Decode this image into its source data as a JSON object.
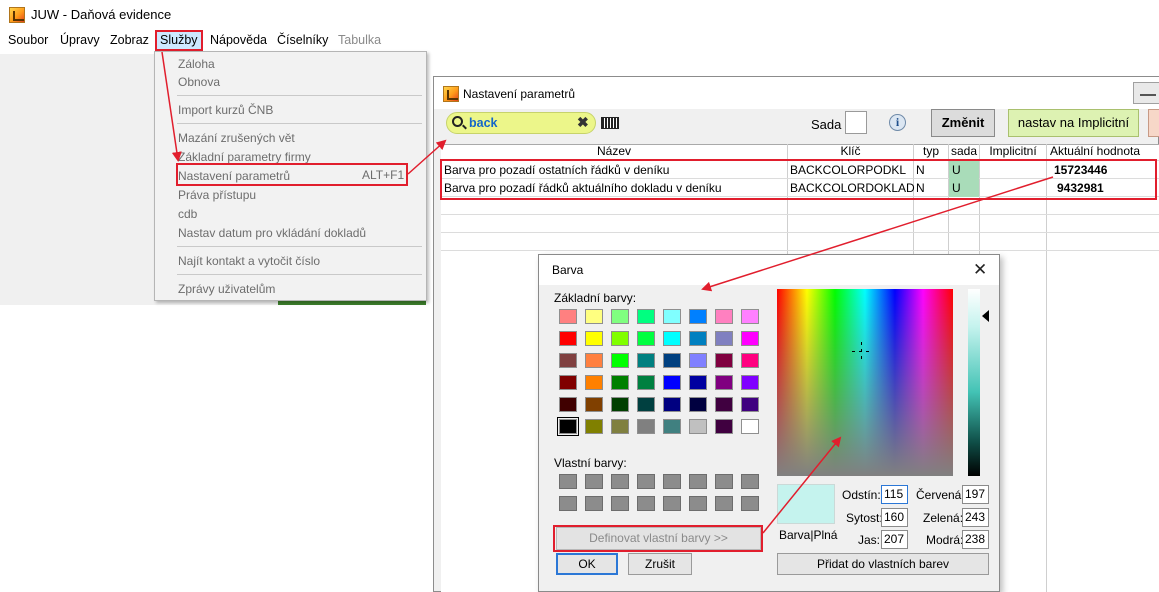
{
  "main_window": {
    "title": "JUW - Daňová evidence",
    "menu": [
      "Soubor",
      "Úpravy",
      "Zobraz",
      "Služby",
      "Nápověda",
      "Číselníky",
      "Tabulka"
    ]
  },
  "dropdown": {
    "items": [
      "Záloha",
      "Obnova",
      "Import kurzů ČNB",
      "Mazání zrušených vět",
      "Základní parametry firmy",
      "Nastavení parametrů",
      "Práva přístupu",
      "cdb",
      "Nastav datum pro vkládání dokladů",
      "Najít kontakt a vytočit číslo",
      "Zprávy uživatelům"
    ],
    "shortcut": "ALT+F1"
  },
  "params_window": {
    "title": "Nastavení parametrů",
    "search_value": "back",
    "clear_glyph": "✖",
    "sada_label": "Sada",
    "info_glyph": "i",
    "btn_change": "Změnit",
    "btn_implicit": "nastav na Implicitní",
    "columns": [
      "Název",
      "Klíč",
      "typ",
      "sada",
      "Implicitní",
      "Aktuální hodnota"
    ],
    "rows": [
      {
        "name": "Barva pro pozadí ostatních řádků v deníku",
        "key": "BACKCOLORPODKL",
        "type": "N",
        "sada": "U",
        "implicit": "",
        "value": "15723446"
      },
      {
        "name": "Barva pro pozadí řádků aktuálního dokladu v deníku",
        "key": "BACKCOLORDOKLAD",
        "type": "N",
        "sada": "U",
        "implicit": "",
        "value": "9432981"
      }
    ]
  },
  "color_dialog": {
    "title": "Barva",
    "close_glyph": "✕",
    "basic_label": "Základní barvy:",
    "custom_label": "Vlastní barvy:",
    "define_btn": "Definovat vlastní barvy >>",
    "ok": "OK",
    "cancel": "Zrušit",
    "preview_label": "Barva|Plná",
    "hue_label": "Odstín:",
    "hue": "115",
    "sat_label": "Sytost:",
    "sat": "160",
    "lum_label": "Jas:",
    "lum": "207",
    "red_label": "Červená:",
    "red": "197",
    "green_label": "Zelená:",
    "green": "243",
    "blue_label": "Modrá:",
    "blue": "238",
    "add_btn": "Přidat do vlastních barev",
    "basic_colors": [
      [
        "#ff8080",
        "#ffff80",
        "#80ff80",
        "#00ff80",
        "#80ffff",
        "#0080ff",
        "#ff80c0",
        "#ff80ff"
      ],
      [
        "#ff0000",
        "#ffff00",
        "#80ff00",
        "#00ff40",
        "#00ffff",
        "#0080c0",
        "#8080c0",
        "#ff00ff"
      ],
      [
        "#804040",
        "#ff8040",
        "#00ff00",
        "#008080",
        "#004080",
        "#8080ff",
        "#800040",
        "#ff0080"
      ],
      [
        "#800000",
        "#ff8000",
        "#008000",
        "#008040",
        "#0000ff",
        "#0000a0",
        "#800080",
        "#8000ff"
      ],
      [
        "#400000",
        "#804000",
        "#004000",
        "#004040",
        "#000080",
        "#000040",
        "#400040",
        "#400080"
      ],
      [
        "#000000",
        "#808000",
        "#808040",
        "#808080",
        "#408080",
        "#c0c0c0",
        "#400040",
        "#ffffff"
      ]
    ],
    "preview_color": "#c5f3ee"
  },
  "colors": {
    "annotation_red": "#e11e2d",
    "search_bg": "#ecf68a",
    "sada_cell_bg": "#a9dcb9",
    "implicit_btn_bg": "#ddf2b2"
  }
}
